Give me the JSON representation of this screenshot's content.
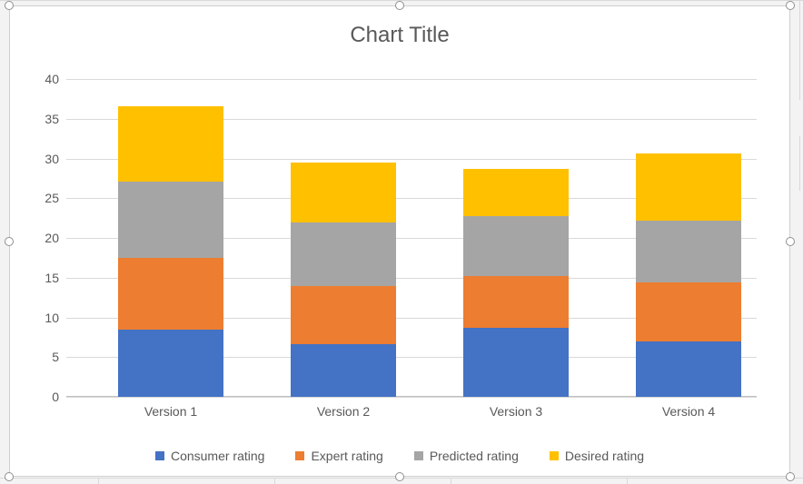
{
  "chart_data": {
    "type": "bar",
    "stacked": true,
    "title": "Chart Title",
    "xlabel": "",
    "ylabel": "",
    "ylim": [
      0,
      40
    ],
    "yticks": [
      0,
      5,
      10,
      15,
      20,
      25,
      30,
      35,
      40
    ],
    "categories": [
      "Version 1",
      "Version 2",
      "Version 3",
      "Version 4"
    ],
    "series": [
      {
        "name": "Consumer rating",
        "color": "#4472C4",
        "values": [
          8.5,
          6.6,
          8.7,
          7.0
        ]
      },
      {
        "name": "Expert rating",
        "color": "#ED7D31",
        "values": [
          9.0,
          7.4,
          6.5,
          7.4
        ]
      },
      {
        "name": "Predicted rating",
        "color": "#A5A5A5",
        "values": [
          9.6,
          8.0,
          7.5,
          7.8
        ]
      },
      {
        "name": "Desired rating",
        "color": "#FFC000",
        "values": [
          9.5,
          7.5,
          6.0,
          8.4
        ]
      }
    ]
  }
}
